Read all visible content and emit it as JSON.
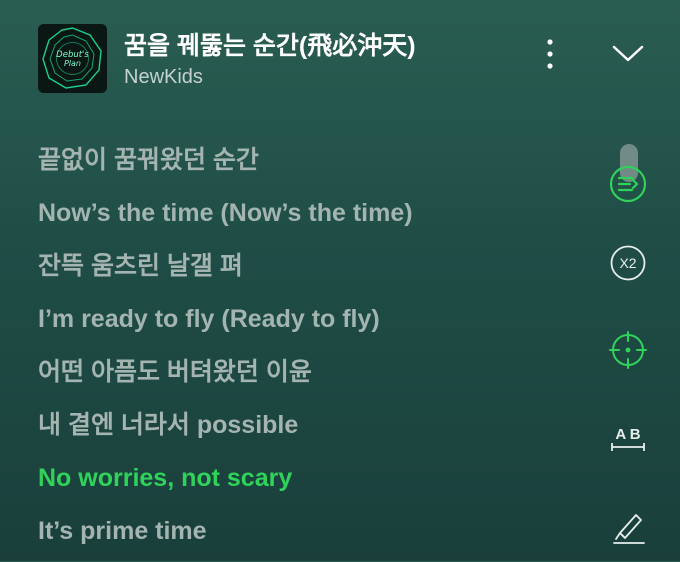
{
  "header": {
    "song_title": "꿈을 꿰뚫는 순간(飛必沖天)",
    "artist": "NewKids",
    "album_art_text": "Debut's Plan"
  },
  "controls": {
    "more_icon": "vertical-ellipsis",
    "collapse_icon": "chevron-down",
    "speed_label": "X2",
    "ab_label": "A B"
  },
  "lyrics": [
    {
      "text": "끝없이 꿈꿔왔던 순간",
      "active": false
    },
    {
      "text": "Now’s the time (Now’s the time)",
      "active": false
    },
    {
      "text": "잔뜩 움츠린 날갤 펴",
      "active": false
    },
    {
      "text": "I’m ready to fly (Ready to fly)",
      "active": false
    },
    {
      "text": "어떤 아픔도 버텨왔던 이윤",
      "active": false
    },
    {
      "text": "내 곁엔 너라서 possible",
      "active": false
    },
    {
      "text": "No worries, not scary",
      "active": true
    },
    {
      "text": "It’s prime time",
      "active": false
    }
  ],
  "side_tools": [
    "scroll-sync-icon",
    "speed-icon",
    "focus-target-icon",
    "ab-repeat-icon",
    "edit-icon"
  ],
  "colors": {
    "accent_green": "#2fd35a",
    "lyric_inactive": "#a4b4b0",
    "background_top": "#2a5d52",
    "background_bottom": "#1a3f3b"
  }
}
